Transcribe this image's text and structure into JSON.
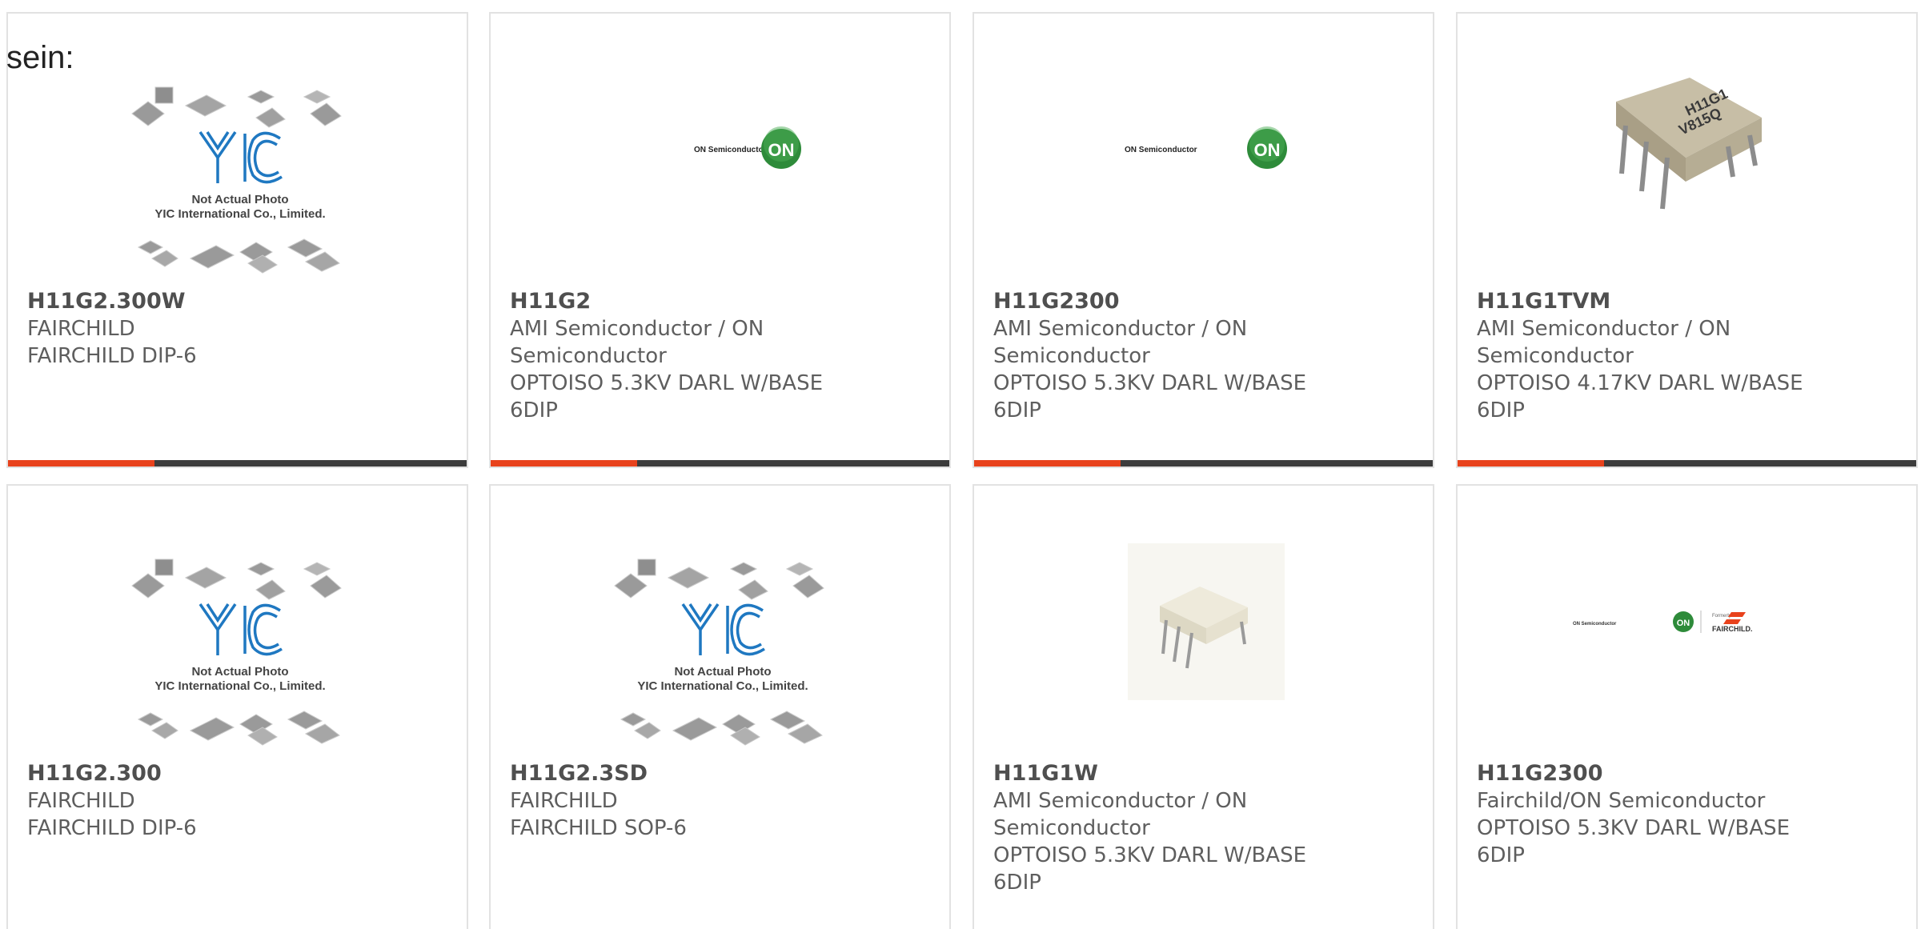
{
  "intro_text": "sein:",
  "placeholder_photo": {
    "line1": "Not Actual Photo",
    "line2": "YIC International Co., Limited."
  },
  "on_semi_logo": {
    "text": "ON Semiconductor",
    "badge": "ON"
  },
  "fairchild_logo": {
    "onsemi_text": "ON Semiconductor",
    "badge": "ON",
    "formerly": "Formerly",
    "brand": "FAIRCHILD."
  },
  "chip_marking": {
    "line1": "H11G1",
    "line2": "V815Q"
  },
  "colors": {
    "accent": "#e8421c",
    "bar": "#3c3c3c",
    "on_green": "#2e8b3a",
    "yic_blue": "#1f78c1"
  },
  "products": [
    {
      "part": "H11G2.300W",
      "line1": "FAIRCHILD",
      "line2": "FAIRCHILD DIP-6",
      "line3": "",
      "line4": "",
      "image": "yic-placeholder"
    },
    {
      "part": "H11G2",
      "line1": "AMI Semiconductor / ON",
      "line2": "Semiconductor",
      "line3": "OPTOISO 5.3KV DARL W/BASE",
      "line4": "6DIP",
      "image": "on-semiconductor-logo"
    },
    {
      "part": "H11G2300",
      "line1": "AMI Semiconductor / ON",
      "line2": "Semiconductor",
      "line3": "OPTOISO 5.3KV DARL W/BASE",
      "line4": "6DIP",
      "image": "on-semiconductor-logo"
    },
    {
      "part": "H11G1TVM",
      "line1": "AMI Semiconductor / ON",
      "line2": "Semiconductor",
      "line3": "OPTOISO 4.17KV DARL W/BASE",
      "line4": "6DIP",
      "image": "dip6-chip-photo"
    },
    {
      "part": "H11G2.300",
      "line1": "FAIRCHILD",
      "line2": "FAIRCHILD DIP-6",
      "line3": "",
      "line4": "",
      "image": "yic-placeholder"
    },
    {
      "part": "H11G2.3SD",
      "line1": "FAIRCHILD",
      "line2": "FAIRCHILD SOP-6",
      "line3": "",
      "line4": "",
      "image": "yic-placeholder"
    },
    {
      "part": "H11G1W",
      "line1": "AMI Semiconductor / ON",
      "line2": "Semiconductor",
      "line3": "OPTOISO 5.3KV DARL W/BASE",
      "line4": "6DIP",
      "image": "white-dip6-chip-photo"
    },
    {
      "part": "H11G2300",
      "line1": "Fairchild/ON Semiconductor",
      "line2": "OPTOISO 5.3KV DARL W/BASE",
      "line3": "6DIP",
      "line4": "",
      "image": "on-fairchild-logo"
    }
  ]
}
